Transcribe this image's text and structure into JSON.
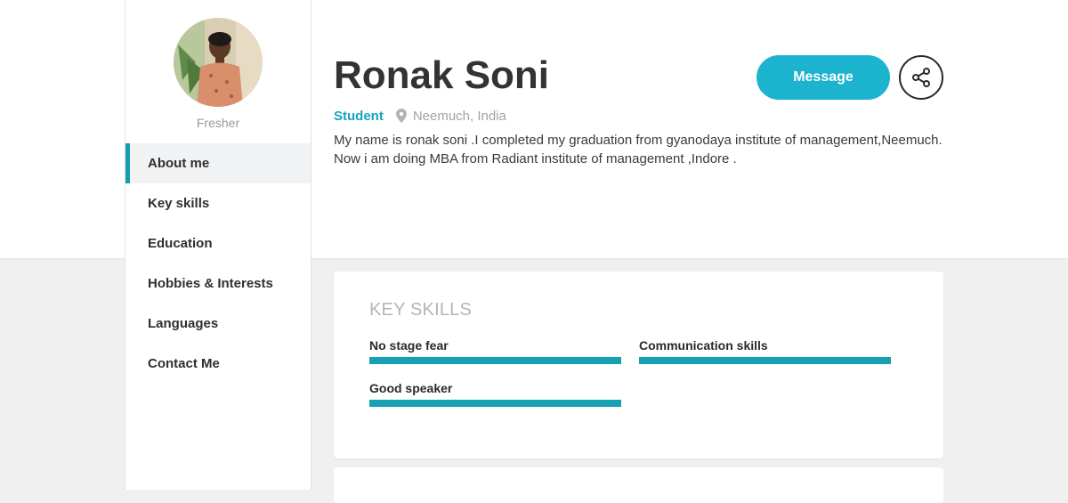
{
  "profile": {
    "name": "Ronak Soni",
    "status": "Fresher",
    "role": "Student",
    "location": "Neemuch, India",
    "bio_line1": "My name is ronak soni .I completed my graduation from gyanodaya institute of management,Neemuch.",
    "bio_line2": "Now i am doing MBA from Radiant institute of management ,Indore ."
  },
  "actions": {
    "message_label": "Message",
    "share_icon": "share-icon"
  },
  "nav": {
    "items": [
      {
        "label": "About me"
      },
      {
        "label": "Key skills"
      },
      {
        "label": "Education"
      },
      {
        "label": "Hobbies & Interests"
      },
      {
        "label": "Languages"
      },
      {
        "label": "Contact Me"
      }
    ],
    "active": "About me"
  },
  "skills": {
    "title": "KEY SKILLS",
    "items": [
      {
        "label": "No stage fear",
        "level": 1.0
      },
      {
        "label": "Communication skills",
        "level": 1.0
      },
      {
        "label": "Good speaker",
        "level": 1.0
      }
    ]
  },
  "colors": {
    "accent": "#1cb3ce",
    "bar": "#16a0b1",
    "role": "#17a4bd"
  }
}
